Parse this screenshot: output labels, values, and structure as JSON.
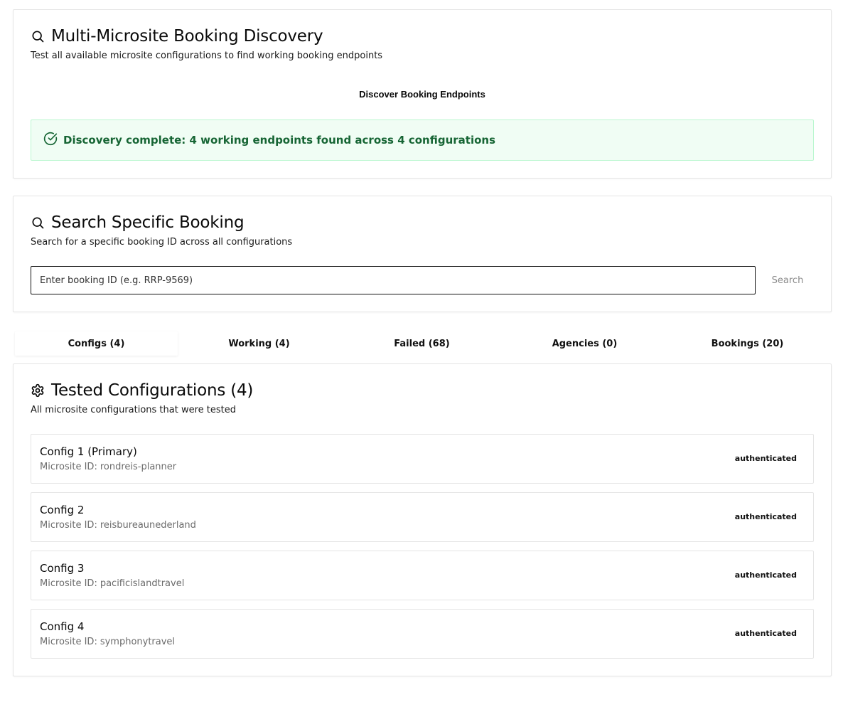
{
  "discovery": {
    "title": "Multi-Microsite Booking Discovery",
    "description": "Test all available microsite configurations to find working booking endpoints",
    "button_label": "Discover Booking Endpoints",
    "status_message": "Discovery complete: 4 working endpoints found across 4 configurations",
    "title_icon": "search-icon",
    "status_icon": "check-circle-icon",
    "status_color": "#166534"
  },
  "search": {
    "title": "Search Specific Booking",
    "description": "Search for a specific booking ID across all configurations",
    "placeholder": "Enter booking ID (e.g. RRP-9569)",
    "value": "",
    "button_label": "Search",
    "title_icon": "search-icon"
  },
  "tabs": [
    {
      "label": "Configs (4)",
      "active": true
    },
    {
      "label": "Working (4)",
      "active": false
    },
    {
      "label": "Failed (68)",
      "active": false
    },
    {
      "label": "Agencies (0)",
      "active": false
    },
    {
      "label": "Bookings (20)",
      "active": false
    }
  ],
  "configs": {
    "title": "Tested Configurations (4)",
    "description": "All microsite configurations that were tested",
    "title_icon": "gear-icon",
    "id_label": "Microsite ID:",
    "items": [
      {
        "name": "Config 1 (Primary)",
        "microsite_id": "rondreis-planner",
        "status": "authenticated"
      },
      {
        "name": "Config 2",
        "microsite_id": "reisbureaunederland",
        "status": "authenticated"
      },
      {
        "name": "Config 3",
        "microsite_id": "pacificislandtravel",
        "status": "authenticated"
      },
      {
        "name": "Config 4",
        "microsite_id": "symphonytravel",
        "status": "authenticated"
      }
    ]
  }
}
